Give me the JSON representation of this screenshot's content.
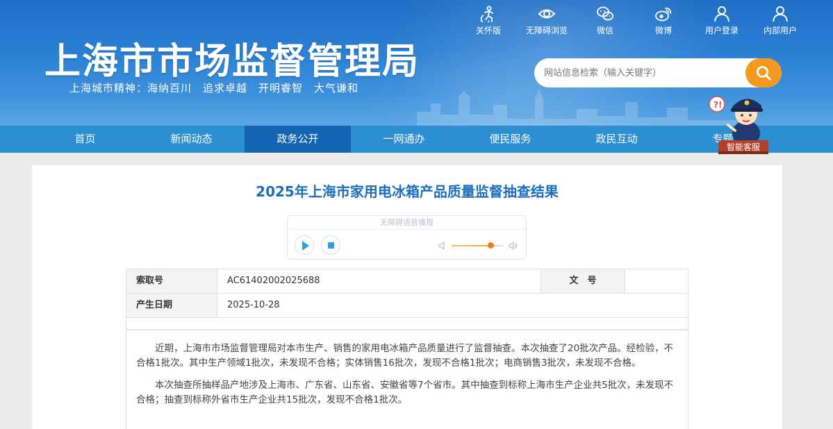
{
  "header": {
    "site_title": "上海市市场监督管理局",
    "slogan": "上海城市精神：海纳百川　追求卓越　开明睿智　大气谦和",
    "toplinks": [
      {
        "label": "关怀版",
        "icon": "accessibility-icon"
      },
      {
        "label": "无障碍浏览",
        "icon": "eye-icon"
      },
      {
        "label": "微信",
        "icon": "wechat-icon"
      },
      {
        "label": "微博",
        "icon": "weibo-icon"
      },
      {
        "label": "用户登录",
        "icon": "user-icon"
      },
      {
        "label": "内部用户",
        "icon": "user-icon"
      }
    ],
    "search": {
      "placeholder": "网站信息检索（输入关键字）"
    }
  },
  "nav": {
    "items": [
      "首页",
      "新闻动态",
      "政务公开",
      "一网通办",
      "便民服务",
      "政民互动",
      "专题"
    ],
    "active": "政务公开"
  },
  "mascot": {
    "label": "智能客服"
  },
  "article": {
    "title": "2025年上海市家用电冰箱产品质量监督抽查结果",
    "player": {
      "label": "无障碍语音播报"
    },
    "info": {
      "index_label": "索取号",
      "index_value": "AC61402002025688",
      "docno_label": "文　号",
      "docno_value": "",
      "date_label": "产生日期",
      "date_value": "2025-10-28"
    },
    "paragraphs": [
      "近期，上海市市场监督管理局对本市生产、销售的家用电冰箱产品质量进行了监督抽查。本次抽查了20批次产品。经检验，不合格1批次。其中生产领域1批次，未发现不合格；实体销售16批次，发现不合格1批次；电商销售3批次，未发现不合格。",
      "本次抽查所抽样品产地涉及上海市、广东省、山东省、安徽省等7个省市。其中抽查到标称上海市生产企业共5批次，未发现不合格；抽查到标称外省市生产企业共15批次，发现不合格1批次。"
    ]
  },
  "colors": {
    "header_blue": "#2a7fd3",
    "nav_blue": "#2c8fd1",
    "nav_active": "#1464b4",
    "title_blue": "#1a6fbf",
    "accent_orange": "#f39a1f"
  }
}
